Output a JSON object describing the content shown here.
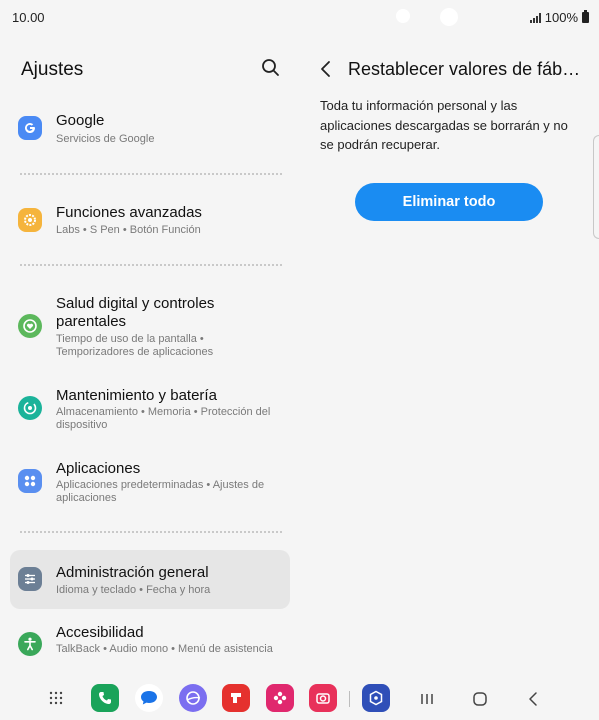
{
  "status_bar": {
    "time": "10.00",
    "battery": "100%"
  },
  "left_panel": {
    "title": "Ajustes",
    "items": [
      {
        "title": "Google",
        "subtitle": "Servicios de Google",
        "icon": "google-icon",
        "color": "#4a8af4"
      },
      {
        "title": "Funciones avanzadas",
        "subtitle": "Labs  •  S Pen  •  Botón Función",
        "icon": "star-gear-icon",
        "color": "#f5b43c"
      },
      {
        "title": "Salud digital y controles parentales",
        "subtitle": "Tiempo de uso de la pantalla  •  Temporizadores de aplicaciones",
        "icon": "heart-timer-icon",
        "color": "#5cb85c"
      },
      {
        "title": "Mantenimiento y batería",
        "subtitle": "Almacenamiento  •  Memoria  •  Protección del dispositivo",
        "icon": "maintenance-icon",
        "color": "#1bb39a"
      },
      {
        "title": "Aplicaciones",
        "subtitle": "Aplicaciones predeterminadas  •  Ajustes de aplicaciones",
        "icon": "apps-grid-icon",
        "color": "#5a8ff0"
      },
      {
        "title": "Administración general",
        "subtitle": "Idioma y teclado  •  Fecha y hora",
        "icon": "sliders-icon",
        "color": "#6c7f95"
      },
      {
        "title": "Accesibilidad",
        "subtitle": "TalkBack  •  Audio mono  •  Menú de asistencia",
        "icon": "accessibility-icon",
        "color": "#3aa85a"
      }
    ]
  },
  "right_panel": {
    "title": "Restablecer valores de fáb…",
    "description": "Toda tu información personal y las aplicaciones descargadas se borrarán y no se podrán recuperar.",
    "button_label": "Eliminar todo",
    "accent": "#1a8cf2"
  },
  "taskbar": {
    "apps": [
      "apps-drawer-icon",
      "phone-icon",
      "messages-icon",
      "internet-icon",
      "flipboard-icon",
      "gallery-icon",
      "camera-icon",
      "secure-folder-icon"
    ],
    "nav": [
      "recents-icon",
      "home-icon",
      "back-icon"
    ]
  }
}
